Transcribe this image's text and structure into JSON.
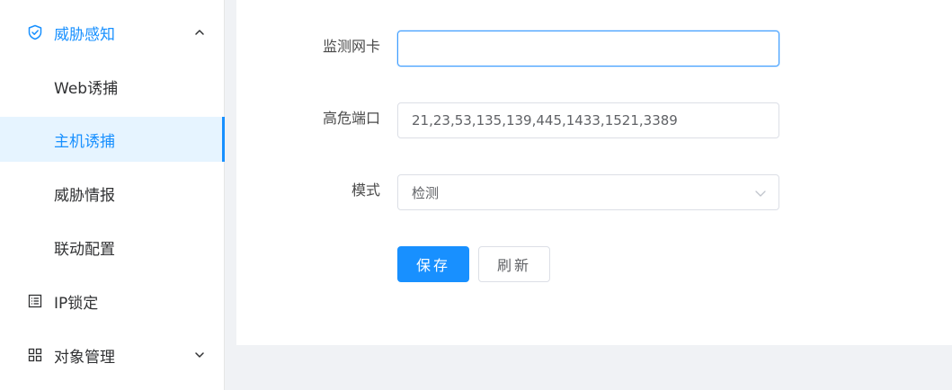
{
  "sidebar": {
    "items": [
      {
        "label": "威胁感知",
        "icon": "shield-check-icon",
        "arrow": "chevron-up-icon"
      },
      {
        "label": "Web诱捕"
      },
      {
        "label": "主机诱捕"
      },
      {
        "label": "威胁情报"
      },
      {
        "label": "联动配置"
      },
      {
        "label": "IP锁定",
        "icon": "list-icon"
      },
      {
        "label": "对象管理",
        "icon": "grid-icon",
        "arrow": "chevron-down-icon"
      }
    ]
  },
  "form": {
    "nic_label": "监测网卡",
    "nic_value": "",
    "ports_label": "高危端口",
    "ports_value": "21,23,53,135,139,445,1433,1521,3389",
    "mode_label": "模式",
    "mode_value": "检测"
  },
  "buttons": {
    "save": "保存",
    "refresh": "刷新"
  },
  "colors": {
    "accent": "#1890ff",
    "active_bg": "#e6f4ff",
    "page_bg": "#f0f2f5"
  }
}
